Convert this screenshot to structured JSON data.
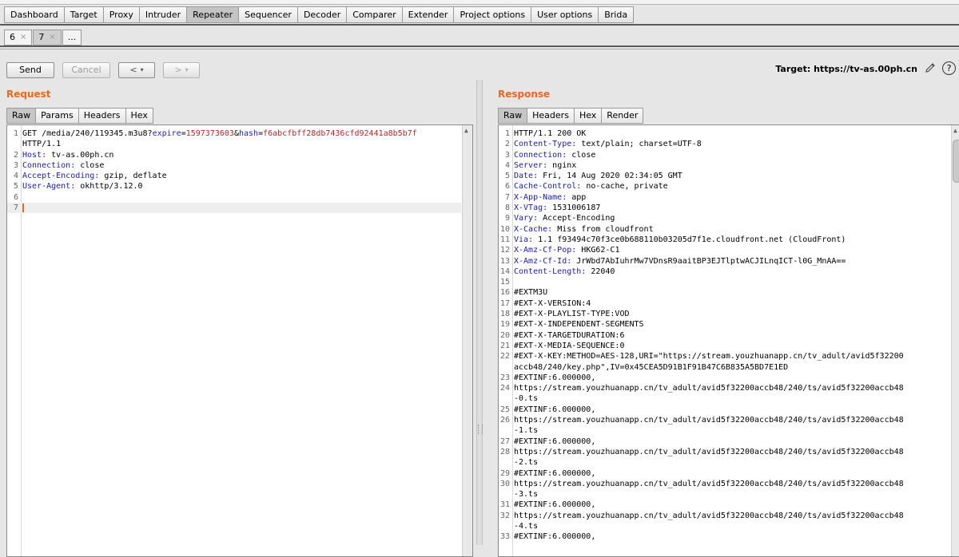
{
  "main_tabs": [
    "Dashboard",
    "Target",
    "Proxy",
    "Intruder",
    "Repeater",
    "Sequencer",
    "Decoder",
    "Comparer",
    "Extender",
    "Project options",
    "User options",
    "Brida"
  ],
  "active_main_tab": "Repeater",
  "sub_tabs": [
    {
      "label": "6",
      "close": "×"
    },
    {
      "label": "7",
      "close": "×"
    },
    {
      "label": "...",
      "close": ""
    }
  ],
  "active_sub_tab": "7",
  "toolbar": {
    "send": "Send",
    "cancel": "Cancel",
    "back": "<",
    "forward": ">",
    "dropdown": "▾",
    "target": "Target: https://tv-as.00ph.cn",
    "help": "?"
  },
  "request": {
    "title": "Request",
    "tabs": [
      "Raw",
      "Params",
      "Headers",
      "Hex"
    ],
    "active_tab": "Raw",
    "lines": [
      {
        "n": "1",
        "segs": [
          [
            "",
            "GET /media/240/119345.m3u8?"
          ],
          [
            "p",
            "expire"
          ],
          [
            "",
            "="
          ],
          [
            "v",
            "1597373603"
          ],
          [
            "",
            "&"
          ],
          [
            "p",
            "hash"
          ],
          [
            "",
            "="
          ],
          [
            "v",
            "f6abcfbff28db7436cfd92441a8b5b7f"
          ]
        ],
        "cont": [
          [
            [
              "",
              "HTTP/1.1"
            ]
          ]
        ]
      },
      {
        "n": "2",
        "segs": [
          [
            "h",
            "Host:"
          ],
          [
            "",
            " tv-as.00ph.cn"
          ]
        ]
      },
      {
        "n": "3",
        "segs": [
          [
            "h",
            "Connection:"
          ],
          [
            "",
            " close"
          ]
        ]
      },
      {
        "n": "4",
        "segs": [
          [
            "h",
            "Accept-Encoding:"
          ],
          [
            "",
            " gzip, deflate"
          ]
        ]
      },
      {
        "n": "5",
        "segs": [
          [
            "h",
            "User-Agent:"
          ],
          [
            "",
            " okhttp/3.12.0"
          ]
        ]
      },
      {
        "n": "6",
        "segs": []
      },
      {
        "n": "7",
        "segs": [],
        "caret": true
      }
    ]
  },
  "response": {
    "title": "Response",
    "tabs": [
      "Raw",
      "Headers",
      "Hex",
      "Render"
    ],
    "active_tab": "Raw",
    "lines": [
      {
        "n": "1",
        "segs": [
          [
            "",
            "HTTP/1.1 200 OK"
          ]
        ]
      },
      {
        "n": "2",
        "segs": [
          [
            "h",
            "Content-Type:"
          ],
          [
            "",
            " text/plain; charset=UTF-8"
          ]
        ]
      },
      {
        "n": "3",
        "segs": [
          [
            "h",
            "Connection:"
          ],
          [
            "",
            " close"
          ]
        ]
      },
      {
        "n": "4",
        "segs": [
          [
            "h",
            "Server:"
          ],
          [
            "",
            " nginx"
          ]
        ]
      },
      {
        "n": "5",
        "segs": [
          [
            "h",
            "Date:"
          ],
          [
            "",
            " Fri, 14 Aug 2020 02:34:05 GMT"
          ]
        ]
      },
      {
        "n": "6",
        "segs": [
          [
            "h",
            "Cache-Control:"
          ],
          [
            "",
            " no-cache, private"
          ]
        ]
      },
      {
        "n": "7",
        "segs": [
          [
            "h",
            "X-App-Name:"
          ],
          [
            "",
            " app"
          ]
        ]
      },
      {
        "n": "8",
        "segs": [
          [
            "h",
            "X-VTag:"
          ],
          [
            "",
            " 1531006187"
          ]
        ]
      },
      {
        "n": "9",
        "segs": [
          [
            "h",
            "Vary:"
          ],
          [
            "",
            " Accept-Encoding"
          ]
        ]
      },
      {
        "n": "10",
        "segs": [
          [
            "h",
            "X-Cache:"
          ],
          [
            "",
            " Miss from cloudfront"
          ]
        ]
      },
      {
        "n": "11",
        "segs": [
          [
            "h",
            "Via:"
          ],
          [
            "",
            " 1.1 f93494c70f3ce0b688110b03205d7f1e.cloudfront.net (CloudFront)"
          ]
        ]
      },
      {
        "n": "12",
        "segs": [
          [
            "h",
            "X-Amz-Cf-Pop:"
          ],
          [
            "",
            " HKG62-C1"
          ]
        ]
      },
      {
        "n": "13",
        "segs": [
          [
            "h",
            "X-Amz-Cf-Id:"
          ],
          [
            "",
            " JrWbd7AbIuhrMw7VDnsR9aaitBP3EJTlptwACJILnqICT-l0G_MnAA=="
          ]
        ]
      },
      {
        "n": "14",
        "segs": [
          [
            "h",
            "Content-Length:"
          ],
          [
            "",
            " 22040"
          ]
        ]
      },
      {
        "n": "15",
        "segs": []
      },
      {
        "n": "16",
        "segs": [
          [
            "",
            "#EXTM3U"
          ]
        ]
      },
      {
        "n": "17",
        "segs": [
          [
            "",
            "#EXT-X-VERSION:4"
          ]
        ]
      },
      {
        "n": "18",
        "segs": [
          [
            "",
            "#EXT-X-PLAYLIST-TYPE:VOD"
          ]
        ]
      },
      {
        "n": "19",
        "segs": [
          [
            "",
            "#EXT-X-INDEPENDENT-SEGMENTS"
          ]
        ]
      },
      {
        "n": "20",
        "segs": [
          [
            "",
            "#EXT-X-TARGETDURATION:6"
          ]
        ]
      },
      {
        "n": "21",
        "segs": [
          [
            "",
            "#EXT-X-MEDIA-SEQUENCE:0"
          ]
        ]
      },
      {
        "n": "22",
        "segs": [
          [
            "",
            "#EXT-X-KEY:METHOD=AES-128,URI=\"https://stream.youzhuanapp.cn/tv_adult/avid5f32200"
          ]
        ],
        "cont": [
          [
            [
              "",
              "accb48/240/key.php\",IV=0x45CEA5D91B1F91B47C6B835A5BD7E1ED"
            ]
          ]
        ]
      },
      {
        "n": "23",
        "segs": [
          [
            "",
            "#EXTINF:6.000000,"
          ]
        ]
      },
      {
        "n": "24",
        "segs": [
          [
            "",
            "https://stream.youzhuanapp.cn/tv_adult/avid5f32200accb48/240/ts/avid5f32200accb48"
          ]
        ],
        "cont": [
          [
            [
              "",
              "-0.ts"
            ]
          ]
        ]
      },
      {
        "n": "25",
        "segs": [
          [
            "",
            "#EXTINF:6.000000,"
          ]
        ]
      },
      {
        "n": "26",
        "segs": [
          [
            "",
            "https://stream.youzhuanapp.cn/tv_adult/avid5f32200accb48/240/ts/avid5f32200accb48"
          ]
        ],
        "cont": [
          [
            [
              "",
              "-1.ts"
            ]
          ]
        ]
      },
      {
        "n": "27",
        "segs": [
          [
            "",
            "#EXTINF:6.000000,"
          ]
        ]
      },
      {
        "n": "28",
        "segs": [
          [
            "",
            "https://stream.youzhuanapp.cn/tv_adult/avid5f32200accb48/240/ts/avid5f32200accb48"
          ]
        ],
        "cont": [
          [
            [
              "",
              "-2.ts"
            ]
          ]
        ]
      },
      {
        "n": "29",
        "segs": [
          [
            "",
            "#EXTINF:6.000000,"
          ]
        ]
      },
      {
        "n": "30",
        "segs": [
          [
            "",
            "https://stream.youzhuanapp.cn/tv_adult/avid5f32200accb48/240/ts/avid5f32200accb48"
          ]
        ],
        "cont": [
          [
            [
              "",
              "-3.ts"
            ]
          ]
        ]
      },
      {
        "n": "31",
        "segs": [
          [
            "",
            "#EXTINF:6.000000,"
          ]
        ]
      },
      {
        "n": "32",
        "segs": [
          [
            "",
            "https://stream.youzhuanapp.cn/tv_adult/avid5f32200accb48/240/ts/avid5f32200accb48"
          ]
        ],
        "cont": [
          [
            [
              "",
              "-4.ts"
            ]
          ]
        ]
      },
      {
        "n": "33",
        "segs": [
          [
            "",
            "#EXTINF:6.000000,"
          ]
        ]
      }
    ]
  },
  "colors": {
    "accent": "#e26a25",
    "header_name": "#1a1ab3",
    "param_name": "#2020c0",
    "param_value": "#b3262b"
  },
  "icons": {
    "edit": "pencil-icon",
    "help": "help-icon",
    "close": "close-icon",
    "scroll": "scroll-up-arrow-icon"
  }
}
